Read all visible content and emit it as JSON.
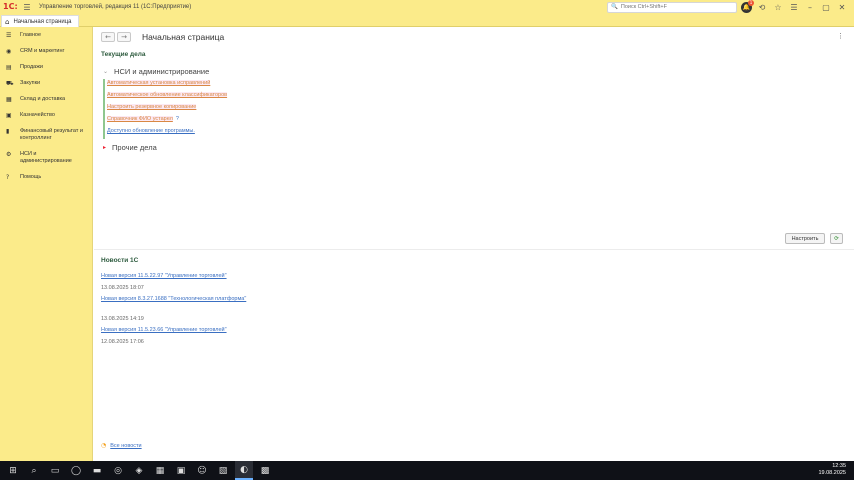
{
  "app": {
    "logo": "1С:",
    "title": "Управление торговлей, редакция 11  (1С:Предприятие)",
    "search_placeholder": "Поиск Ctrl+Shift+F",
    "notification_count": "1"
  },
  "tabs": {
    "home_label": "Начальная страница"
  },
  "sidebar": {
    "items": [
      {
        "icon": "menu-icon",
        "glyph": "☰",
        "label": "Главное"
      },
      {
        "icon": "crm-icon",
        "glyph": "◉",
        "label": "CRM и маркетинг"
      },
      {
        "icon": "sales-icon",
        "glyph": "▤",
        "label": "Продажи"
      },
      {
        "icon": "cart-icon",
        "glyph": "⛟",
        "label": "Закупки"
      },
      {
        "icon": "warehouse-icon",
        "glyph": "▦",
        "label": "Склад и доставка"
      },
      {
        "icon": "treasury-icon",
        "glyph": "▣",
        "label": "Казначейство"
      },
      {
        "icon": "chart-icon",
        "glyph": "▮",
        "label": "Финансовый результат и контроллинг"
      },
      {
        "icon": "gear-icon",
        "glyph": "⚙",
        "label": "НСИ и администрирование"
      },
      {
        "icon": "help-icon",
        "glyph": "?",
        "label": "Помощь"
      }
    ]
  },
  "main": {
    "page_title": "Начальная страница",
    "current_tasks_title": "Текущие дела",
    "group_nsi": "НСИ и администрирование",
    "tasks": [
      {
        "label": "Автоматическая установка исправлений",
        "style": "hl"
      },
      {
        "label": "Автоматическое обновление классификаторов",
        "style": "hl"
      },
      {
        "label": "Настроить резервное копирование",
        "style": "hl"
      },
      {
        "label": "Справочник ФИО устарел",
        "style": "hl",
        "help": "?"
      },
      {
        "label": "Доступно обновление программы.",
        "style": "normal"
      }
    ],
    "group_other": "Прочие дела",
    "configure_button": "Настроить",
    "refresh_glyph": "⟳"
  },
  "news": {
    "title": "Новости 1С",
    "items": [
      {
        "link": "Новая версия 11.5.22.97 \"Управление торговлей\"",
        "date": "13.08.2025 18:07"
      },
      {
        "link": "Новая версия 8.3.27.1688 \"Технологическая платформа\"",
        "date": "13.08.2025 14:19"
      },
      {
        "link": "Новая версия 11.5.23.66 \"Управление торговлей\"",
        "date": "12.08.2025 17:06"
      }
    ],
    "all_news": "Все новости"
  },
  "taskbar": {
    "time": "12:35",
    "date": "19.08.2025"
  },
  "colors": {
    "sidebar_bg": "#fbeb8a",
    "section_title": "#2c5a3d",
    "link": "#3a6fc2",
    "highlight_link": "#d98844"
  }
}
